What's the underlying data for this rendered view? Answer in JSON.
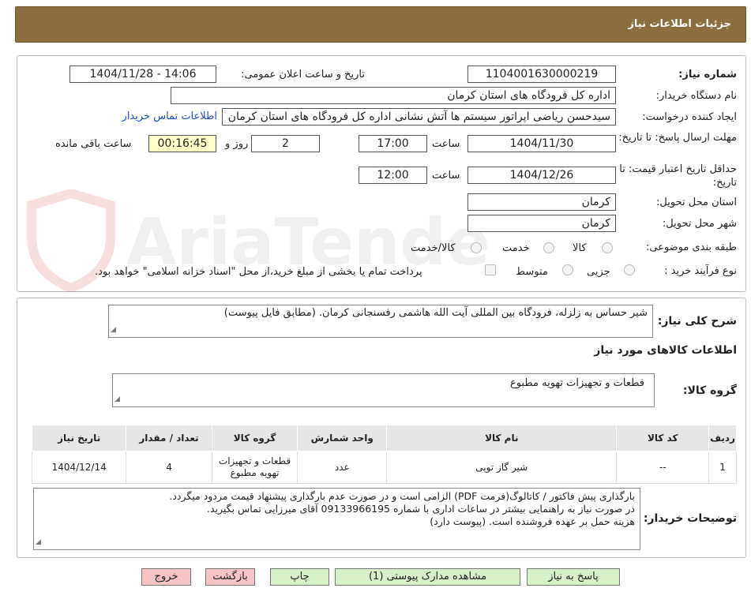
{
  "header": {
    "title": "جزئیات اطلاعات نیاز"
  },
  "watermark": "AriaTender.neT",
  "form": {
    "need_number_label": "شماره نیاز:",
    "need_number": "1104001630000219",
    "announce_label": "تاریخ و ساعت اعلان عمومی:",
    "announce_value": "1404/11/28 - 14:06",
    "buyer_org_label": "نام دستگاه خریدار:",
    "buyer_org": "اداره کل فرودگاه های استان کرمان",
    "creator_label": "ایجاد کننده درخواست:",
    "creator": "سیدحسن ریاضی اپراتور سیستم ها آتش نشانی اداره کل فرودگاه های استان کرمان",
    "contact_link": "اطلاعات تماس خریدار",
    "reply_deadline_label": "مهلت ارسال پاسخ: تا تاریخ:",
    "reply_date": "1404/11/30",
    "time_label": "ساعت",
    "reply_time": "17:00",
    "days": "2",
    "days_label": "روز و",
    "remaining_time": "00:16:45",
    "remaining_label": "ساعت باقی مانده",
    "validity_label": "حداقل تاریخ اعتبار قیمت: تا تاریخ:",
    "validity_date": "1404/12/26",
    "validity_time": "12:00",
    "province_label": "استان محل تحویل:",
    "province": "کرمان",
    "city_label": "شهر محل تحویل:",
    "city": "کرمان",
    "category_label": "طبقه بندی موضوعی:",
    "category_options": [
      "کالا",
      "خدمت",
      "کالا/خدمت"
    ],
    "process_label": "نوع فرآیند خرید :",
    "process_options": [
      "جزیی",
      "متوسط"
    ],
    "payment_note": "پرداخت تمام یا بخشی از مبلغ خرید،از محل \"اسناد خزانه اسلامی\" خواهد بود."
  },
  "details": {
    "summary_label": "شرح کلی نیاز:",
    "summary": "شیر حساس به زلزله، فرودگاه بین المللی آیت الله هاشمی رفسنجانی کرمان. (مطابق فایل پیوست)",
    "goods_info_title": "اطلاعات کالاهای مورد نیاز",
    "group_label": "گروه کالا:",
    "group_value": "قطعات و تجهیزات تهویه مطبوع"
  },
  "table": {
    "headers": [
      "ردیف",
      "کد کالا",
      "نام کالا",
      "واحد شمارش",
      "گروه کالا",
      "تعداد / مقدار",
      "تاریخ نیاز"
    ],
    "rows": [
      [
        "1",
        "--",
        "شیر گاز توپی",
        "عدد",
        "قطعات و تجهیزات تهویه مطبوع",
        "4",
        "1404/12/14"
      ]
    ]
  },
  "buyer_notes": {
    "label": "توضیحات خریدار:",
    "lines": [
      "بارگذاری پیش فاکتور / کاتالوگ(فرمت PDF) الزامی است و در صورت عدم بارگذاری پیشنهاد قیمت مردود میگردد.",
      "در صورت نیاز به راهنمایی بیشتر در ساعات اداری با شماره 09133966195 آقای میرزایی تماس بگیرید.",
      "هزینه حمل بر عهده فروشنده است. (پیوست دارد)"
    ]
  },
  "buttons": {
    "reply": "پاسخ به نیاز",
    "attachments": "مشاهده مدارک پیوستی (1)",
    "print": "چاپ",
    "back": "بازگشت",
    "exit": "خروج"
  }
}
